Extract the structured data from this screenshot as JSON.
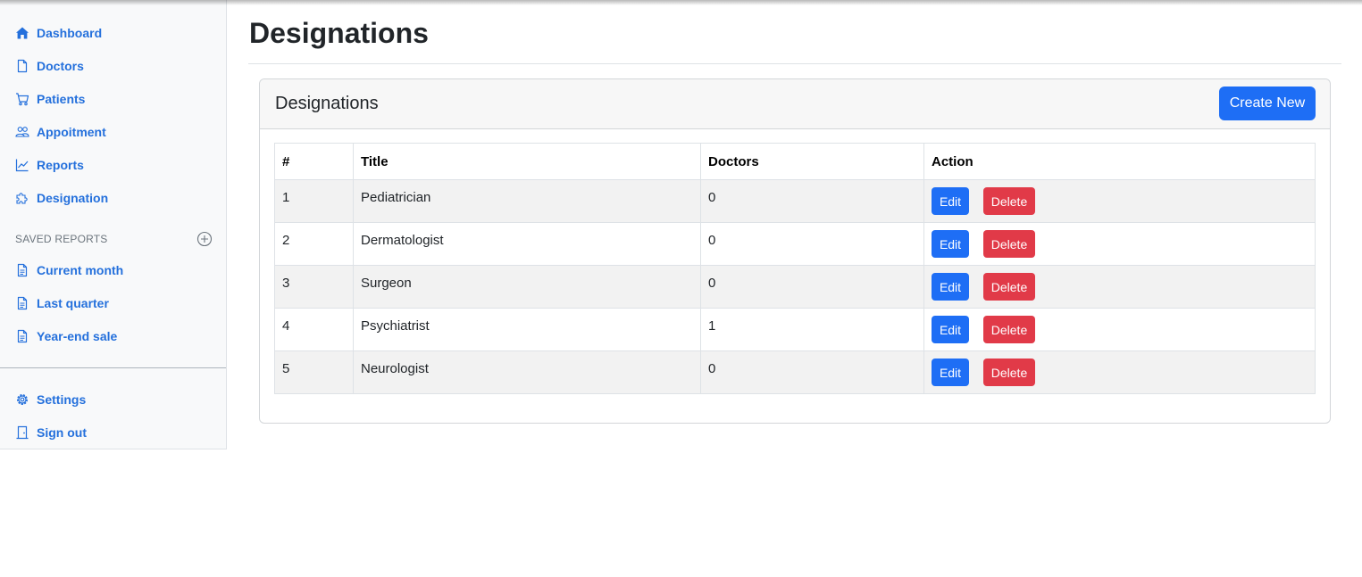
{
  "sidebar": {
    "nav_items": [
      {
        "label": "Dashboard",
        "icon": "house-icon"
      },
      {
        "label": "Doctors",
        "icon": "file-icon"
      },
      {
        "label": "Patients",
        "icon": "cart-icon"
      },
      {
        "label": "Appoitment",
        "icon": "people-icon"
      },
      {
        "label": "Reports",
        "icon": "chart-line-icon"
      },
      {
        "label": "Designation",
        "icon": "puzzle-icon"
      }
    ],
    "saved_reports_heading": "SAVED REPORTS",
    "saved_reports": [
      {
        "label": "Current month",
        "icon": "file-text-icon"
      },
      {
        "label": "Last quarter",
        "icon": "file-text-icon"
      },
      {
        "label": "Year-end sale",
        "icon": "file-text-icon"
      }
    ],
    "bottom_items": [
      {
        "label": "Settings",
        "icon": "gear-icon"
      },
      {
        "label": "Sign out",
        "icon": "door-icon"
      }
    ]
  },
  "page": {
    "title": "Designations"
  },
  "card": {
    "title": "Designations",
    "create_button": "Create New"
  },
  "table": {
    "headers": [
      "#",
      "Title",
      "Doctors",
      "Action"
    ],
    "rows": [
      {
        "num": "1",
        "title": "Pediatrician",
        "doctors": "0"
      },
      {
        "num": "2",
        "title": "Dermatologist",
        "doctors": "0"
      },
      {
        "num": "3",
        "title": "Surgeon",
        "doctors": "0"
      },
      {
        "num": "4",
        "title": "Psychiatrist",
        "doctors": "1"
      },
      {
        "num": "5",
        "title": "Neurologist",
        "doctors": "0"
      }
    ],
    "edit_label": "Edit",
    "delete_label": "Delete"
  },
  "colors": {
    "link": "#2470dc",
    "primary": "#1e6ef5",
    "danger": "#e13a48"
  }
}
